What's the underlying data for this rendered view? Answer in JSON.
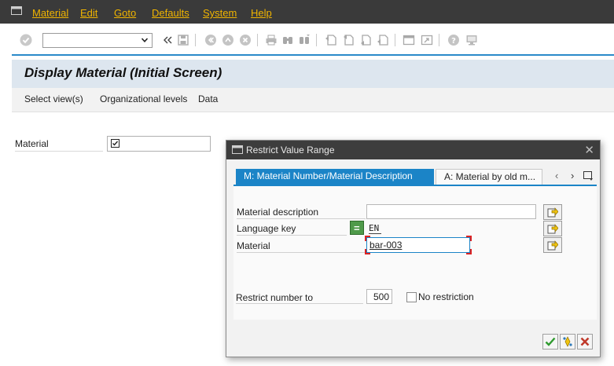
{
  "menubar": {
    "items": [
      "Material",
      "Edit",
      "Goto",
      "Defaults",
      "System",
      "Help"
    ]
  },
  "toolbar": {
    "command_value": "",
    "icons": [
      "enter-icon",
      "back-arrows-icon",
      "save-icon",
      "back-icon",
      "exit-icon",
      "cancel-icon",
      "print-icon",
      "find-icon",
      "find-next-icon",
      "first-page-icon",
      "previous-page-icon",
      "next-page-icon",
      "last-page-icon",
      "new-session-icon",
      "shortcut-icon",
      "help-icon",
      "layout-icon"
    ]
  },
  "title": "Display Material (Initial Screen)",
  "app_toolbar": {
    "buttons": [
      "Select view(s)",
      "Organizational levels",
      "Data"
    ]
  },
  "main": {
    "material_label": "Material",
    "material_value": ""
  },
  "dialog": {
    "title": "Restrict Value Range",
    "tabs": [
      "M: Material Number/Material Description",
      "A: Material by old m..."
    ],
    "fields": {
      "material_description_label": "Material description",
      "material_description_value": "",
      "language_key_label": "Language key",
      "language_key_value": "EN",
      "material_label": "Material",
      "material_value": "bar-003"
    },
    "restrict_label": "Restrict number to",
    "restrict_value": "500",
    "no_restriction_label": "No restriction",
    "no_restriction_checked": false
  },
  "colors": {
    "accent": "#1b84c7",
    "menu_text": "#f0b400",
    "menubar_bg": "#3a3a3a",
    "title_bg": "#dde6ef"
  }
}
